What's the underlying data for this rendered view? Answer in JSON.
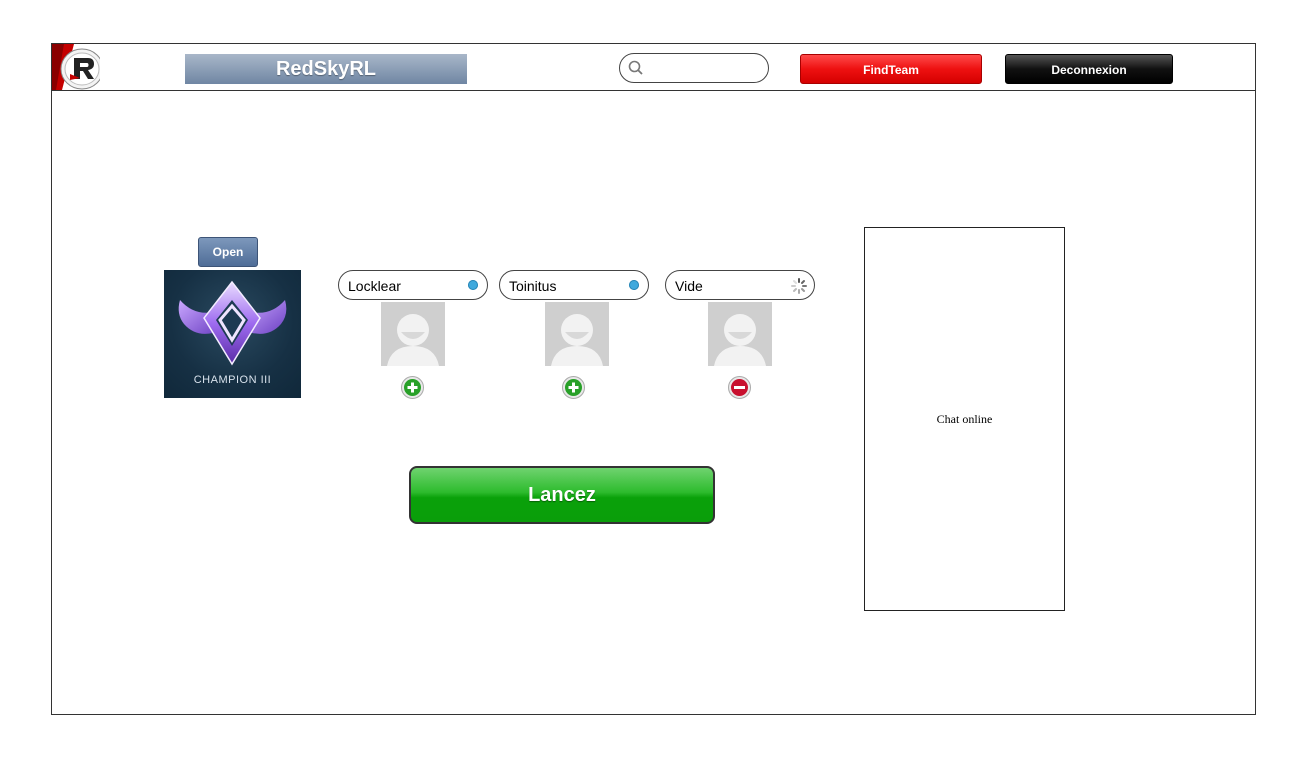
{
  "header": {
    "app_title": "RedSkyRL",
    "search_placeholder": "",
    "findteam_label": "FindTeam",
    "logout_label": "Deconnexion"
  },
  "rank": {
    "open_label": "Open",
    "rank_name": "CHAMPION III"
  },
  "players": [
    {
      "name": "Locklear",
      "status": "online",
      "action": "add"
    },
    {
      "name": "Toinitus",
      "status": "online",
      "action": "add"
    },
    {
      "name": "Vide",
      "status": "loading",
      "action": "remove"
    }
  ],
  "launch_label": "Lancez",
  "chat": {
    "label": "Chat online"
  },
  "colors": {
    "accent_red": "#e00000",
    "launch_green": "#1aab1a",
    "status_blue": "#3fa9dd",
    "title_bar": "#8196b1"
  }
}
